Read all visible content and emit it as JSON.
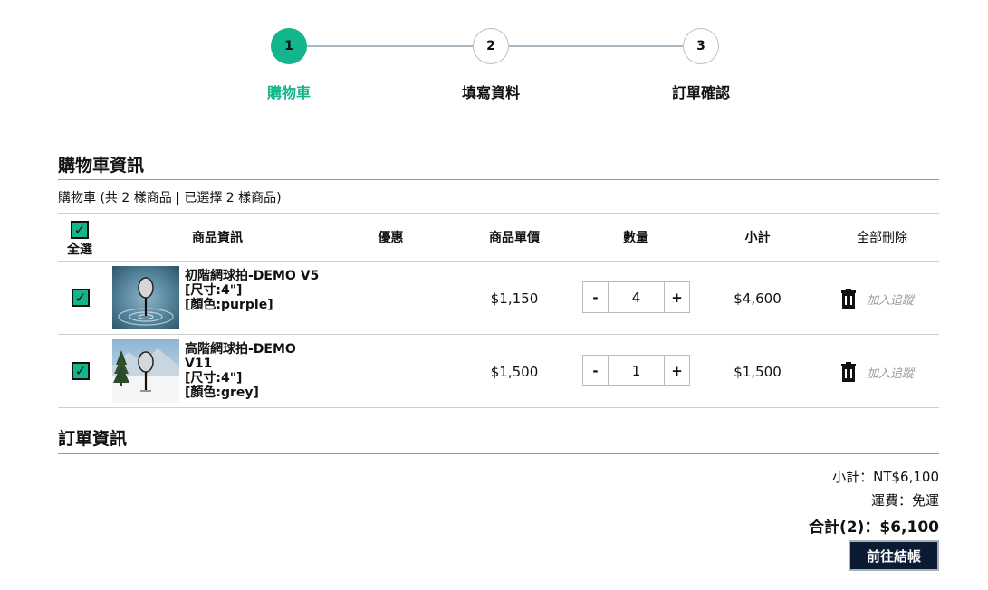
{
  "stepper": {
    "steps": [
      {
        "number": "1",
        "label": "購物車"
      },
      {
        "number": "2",
        "label": "填寫資料"
      },
      {
        "number": "3",
        "label": "訂單確認"
      }
    ],
    "active_step": 1
  },
  "cart_section": {
    "title": "購物車資訊",
    "summary": "購物車 (共 2 樣商品 | 已選擇 2 樣商品)"
  },
  "table": {
    "headers": {
      "select_all": "全選",
      "product_info": "商品資訊",
      "discount": "優惠",
      "unit_price": "商品單價",
      "quantity": "數量",
      "subtotal": "小計",
      "delete_all": "全部刪除"
    },
    "rows": [
      {
        "checked": true,
        "name": "初階網球拍-DEMO V5",
        "size": "[尺寸:4\"]",
        "color": "[顏色:purple]",
        "discount": "",
        "unit_price": "$1,150",
        "qty_minus": "-",
        "quantity": "4",
        "qty_plus": "+",
        "subtotal": "$4,600",
        "track_label": "加入追蹤"
      },
      {
        "checked": true,
        "name": "高階網球拍-DEMO V11",
        "size": "[尺寸:4\"]",
        "color": "[顏色:grey]",
        "discount": "",
        "unit_price": "$1,500",
        "qty_minus": "-",
        "quantity": "1",
        "qty_plus": "+",
        "subtotal": "$1,500",
        "track_label": "加入追蹤"
      }
    ]
  },
  "order_section": {
    "title": "訂單資訊",
    "subtotal": "小計：NT$6,100",
    "shipping": "運費：免運",
    "total": "合計(2)：$6,100",
    "checkout_label": "前往結帳"
  },
  "colors": {
    "accent": "#12b58c",
    "checkout_bg": "#0b1b33"
  },
  "icons": {
    "check": "check-icon",
    "trash": "trash-icon"
  }
}
